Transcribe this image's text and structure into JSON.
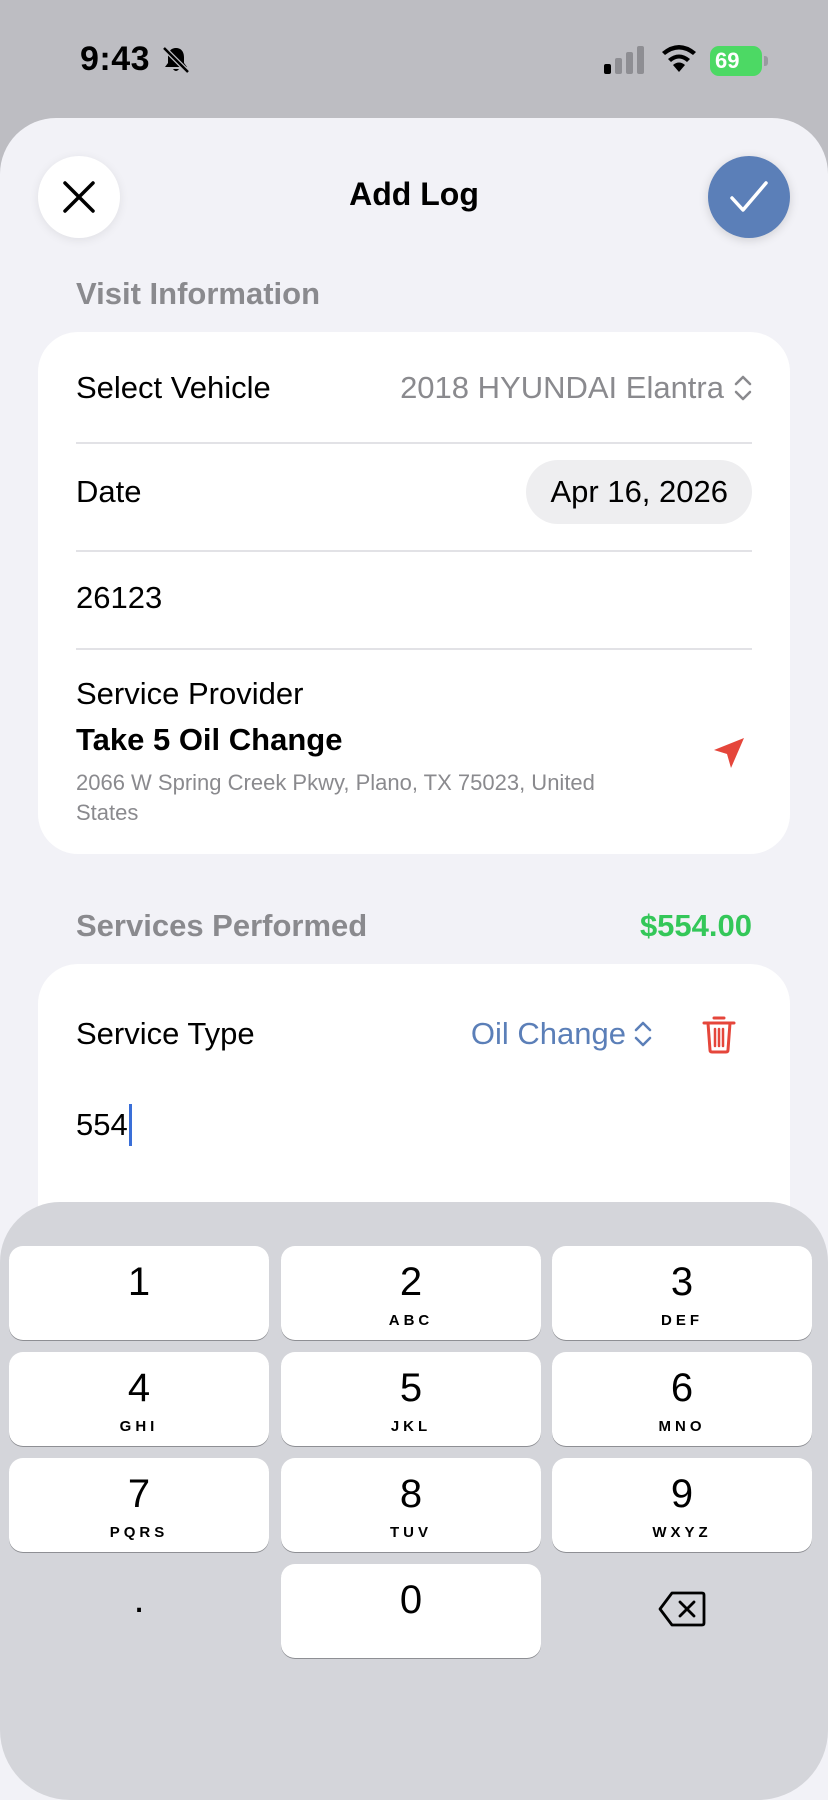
{
  "status_bar": {
    "time": "9:43",
    "battery": "69"
  },
  "header": {
    "title": "Add Log"
  },
  "visit": {
    "section_title": "Visit Information",
    "vehicle_label": "Select Vehicle",
    "vehicle_value": "2018 HYUNDAI Elantra",
    "date_label": "Date",
    "date_value": "Apr 16, 2026",
    "mileage_value": "26123",
    "provider_label": "Service Provider",
    "provider_name": "Take 5 Oil Change",
    "provider_address": "2066 W Spring Creek Pkwy, Plano, TX  75023, United States"
  },
  "services": {
    "section_title": "Services Performed",
    "total": "$554.00",
    "type_label": "Service Type",
    "type_value": "Oil Change",
    "amount_value": "554"
  },
  "keyboard": {
    "keys": [
      {
        "num": "1",
        "letters": ""
      },
      {
        "num": "2",
        "letters": "ABC"
      },
      {
        "num": "3",
        "letters": "DEF"
      },
      {
        "num": "4",
        "letters": "GHI"
      },
      {
        "num": "5",
        "letters": "JKL"
      },
      {
        "num": "6",
        "letters": "MNO"
      },
      {
        "num": "7",
        "letters": "PQRS"
      },
      {
        "num": "8",
        "letters": "TUV"
      },
      {
        "num": "9",
        "letters": "WXYZ"
      },
      {
        "num": "0",
        "letters": ""
      }
    ],
    "decimal": "."
  },
  "colors": {
    "accent": "#5b7fb8",
    "total_green": "#34c759",
    "destructive": "#e5463b",
    "location_red": "#e5463b"
  },
  "icons": [
    "bell-slash-icon",
    "cellular-signal-icon",
    "wifi-icon",
    "battery-icon",
    "close-icon",
    "checkmark-icon",
    "chevron-updown-icon",
    "location-arrow-icon",
    "trash-icon",
    "delete-backspace-icon"
  ]
}
